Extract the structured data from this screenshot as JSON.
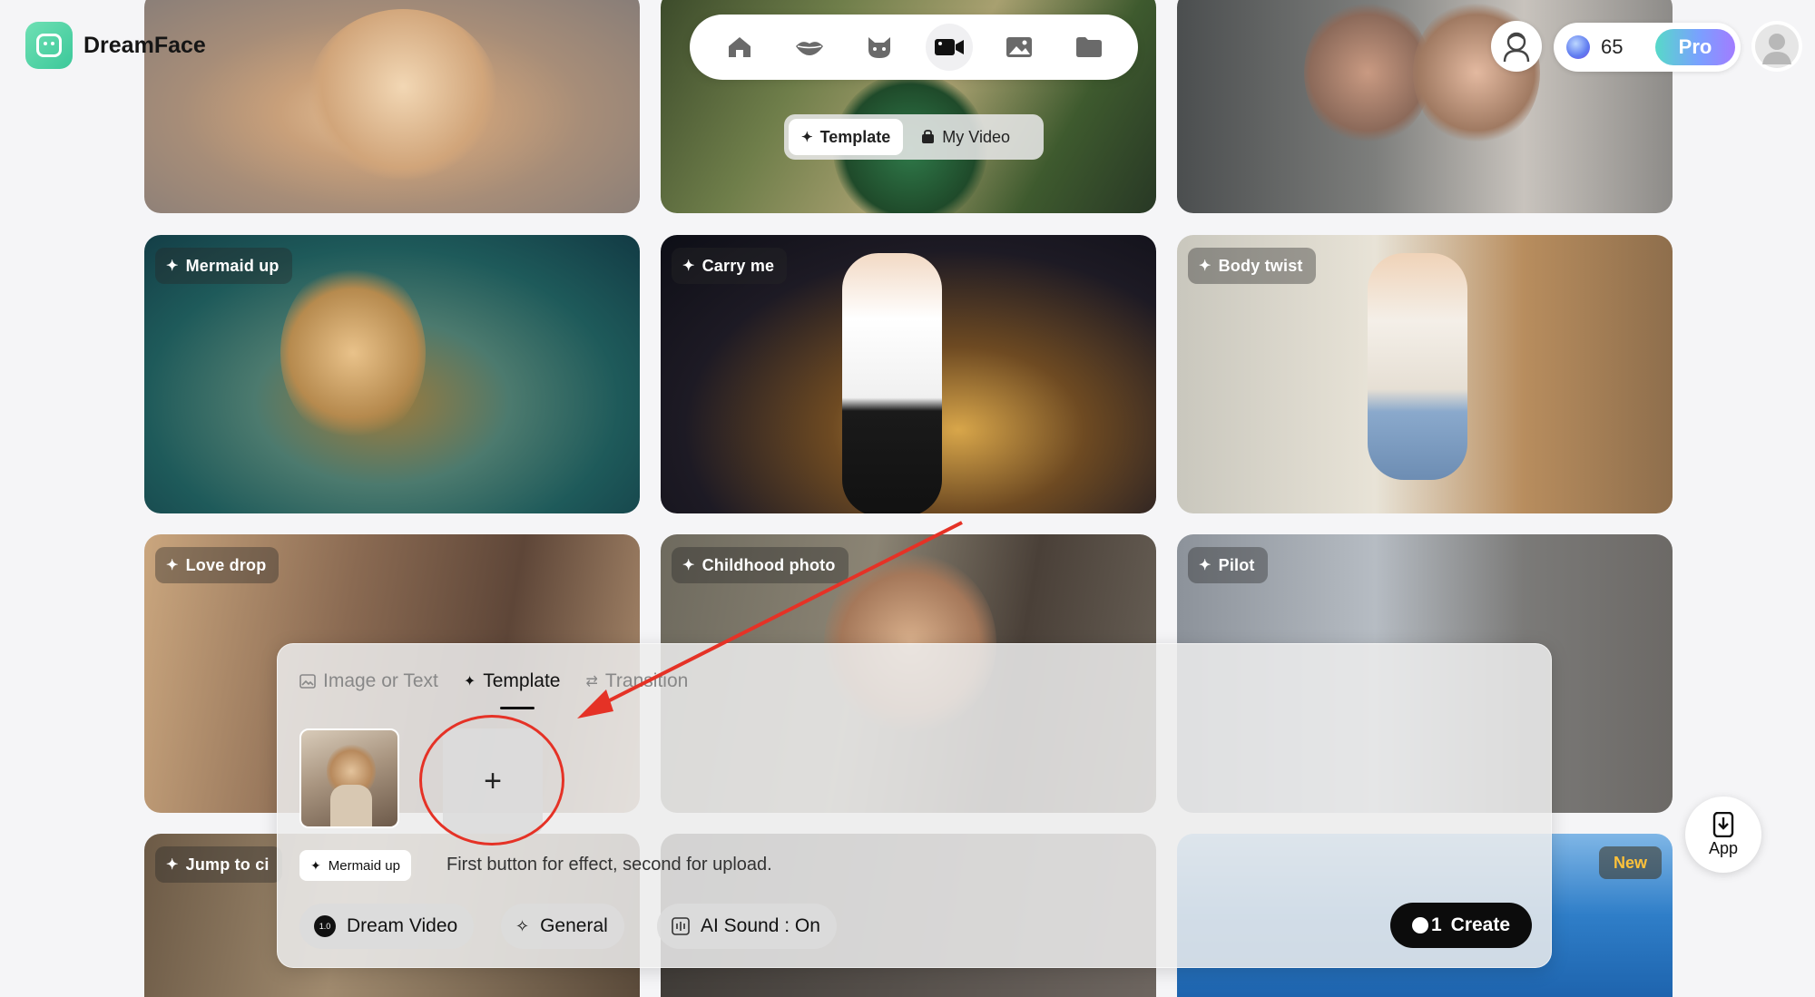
{
  "app": {
    "name": "DreamFace"
  },
  "top_nav": {
    "icons": [
      "home-icon",
      "lips-icon",
      "cat-icon",
      "video-camera-icon",
      "image-icon",
      "folder-icon"
    ],
    "active_icon": "video-camera-icon",
    "sub_tabs": [
      {
        "label": "Template",
        "icon": "sparkle-icon",
        "active": true
      },
      {
        "label": "My Video",
        "icon": "bag-icon",
        "active": false
      }
    ]
  },
  "account": {
    "credits": "65",
    "pro_label": "Pro"
  },
  "cards": [
    {
      "id": "puppy",
      "label": ""
    },
    {
      "id": "fairy",
      "label": ""
    },
    {
      "id": "kiss",
      "label": ""
    },
    {
      "id": "mermaid",
      "label": "Mermaid up"
    },
    {
      "id": "carry",
      "label": "Carry me"
    },
    {
      "id": "body",
      "label": "Body twist"
    },
    {
      "id": "love",
      "label": "Love drop"
    },
    {
      "id": "child",
      "label": "Childhood photo"
    },
    {
      "id": "pilot",
      "label": "Pilot"
    },
    {
      "id": "jump",
      "label": "Jump to ci"
    },
    {
      "id": "pool",
      "label": "",
      "badge": "New"
    }
  ],
  "app_button": {
    "label": "App"
  },
  "panel": {
    "tabs": [
      {
        "label": "Image or Text",
        "icon": "image-icon",
        "active": false
      },
      {
        "label": "Template",
        "icon": "sparkle-icon",
        "active": true
      },
      {
        "label": "Transition",
        "icon": "swap-icon",
        "active": false
      }
    ],
    "upload_symbol": "+",
    "selected_template": "Mermaid up",
    "hint": "First button for effect, second for upload.",
    "model_button": {
      "badge": "1.0",
      "label": "Dream Video"
    },
    "style_button": {
      "label": "General"
    },
    "sound_button": {
      "label": "AI Sound : On"
    },
    "create_button": {
      "cost": "1",
      "label": "Create"
    }
  },
  "colors": {
    "accent": "#e53226",
    "create_bg": "#0c0c0c",
    "new_badge": "#ffc23a"
  }
}
